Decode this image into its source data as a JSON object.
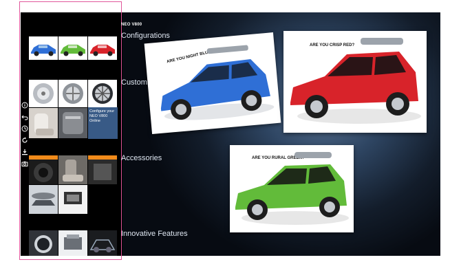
{
  "brand": {
    "model": "NEO V800"
  },
  "sections": [
    {
      "label": "Configurations"
    },
    {
      "label": "Customize"
    },
    {
      "label": "Accessories"
    },
    {
      "label": "Innovative Features"
    }
  ],
  "sidebar": {
    "configure_cta": "Configure your NEO V800 Online"
  },
  "toolbar": {
    "icons": [
      "info-icon",
      "back-icon",
      "history-icon",
      "refresh-icon",
      "download-icon",
      "camera-icon"
    ]
  },
  "cards": [
    {
      "caption": "ARE YOU NIGHT BLUE?",
      "color": "#2f6fd6"
    },
    {
      "caption": "ARE YOU CRISP RED?",
      "color": "#d8232a"
    },
    {
      "caption": "ARE YOU RURAL GREEN?",
      "color": "#62bb3a"
    }
  ],
  "colors": {
    "accent_frame": "#e0559a",
    "cta_bg": "#385a86"
  }
}
